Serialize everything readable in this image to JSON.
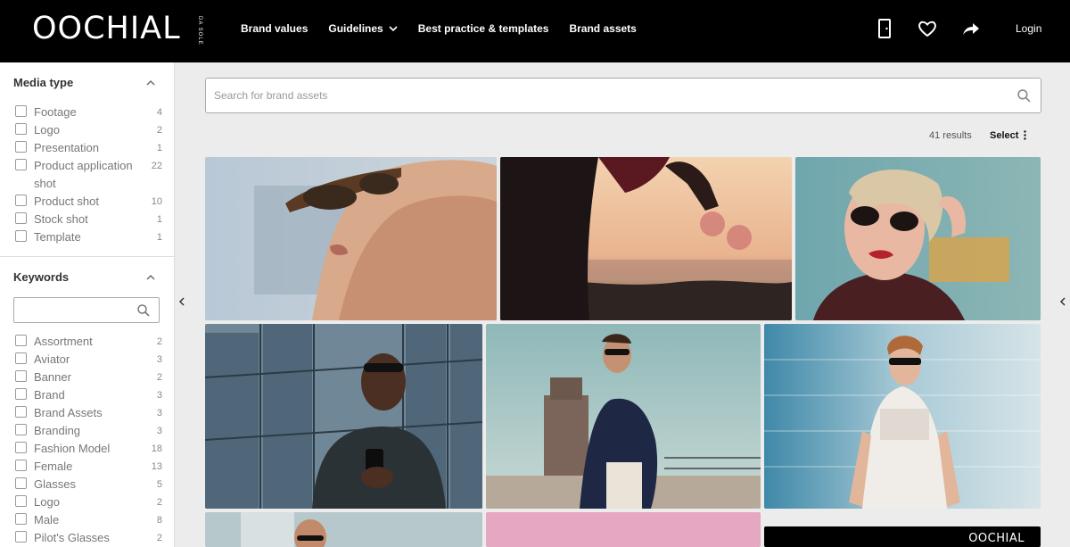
{
  "header": {
    "logo": "OOCHIAL",
    "logo_small": "DA SOLE",
    "nav": [
      "Brand values",
      "Guidelines",
      "Best practice & templates",
      "Brand assets"
    ],
    "login": "Login"
  },
  "sidebar": {
    "media_type": {
      "title": "Media type",
      "items": [
        {
          "label": "Footage",
          "count": "4"
        },
        {
          "label": "Logo",
          "count": "2"
        },
        {
          "label": "Presentation",
          "count": "1"
        },
        {
          "label": "Product application shot",
          "count": "22"
        },
        {
          "label": "Product shot",
          "count": "10"
        },
        {
          "label": "Stock shot",
          "count": "1"
        },
        {
          "label": "Template",
          "count": "1"
        }
      ]
    },
    "keywords": {
      "title": "Keywords",
      "items": [
        {
          "label": "Assortment",
          "count": "2"
        },
        {
          "label": "Aviator",
          "count": "3"
        },
        {
          "label": "Banner",
          "count": "2"
        },
        {
          "label": "Brand",
          "count": "3"
        },
        {
          "label": "Brand Assets",
          "count": "3"
        },
        {
          "label": "Branding",
          "count": "3"
        },
        {
          "label": "Fashion Model",
          "count": "18"
        },
        {
          "label": "Female",
          "count": "13"
        },
        {
          "label": "Glasses",
          "count": "5"
        },
        {
          "label": "Logo",
          "count": "2"
        },
        {
          "label": "Male",
          "count": "8"
        },
        {
          "label": "Pilot's Glasses",
          "count": "2"
        }
      ]
    }
  },
  "main": {
    "search_placeholder": "Search for brand assets",
    "results": "41 results",
    "select_label": "Select",
    "tile_logo": "OOCHIAL"
  },
  "colors": {
    "header_bg": "#000000",
    "accent": "#ffffff"
  }
}
